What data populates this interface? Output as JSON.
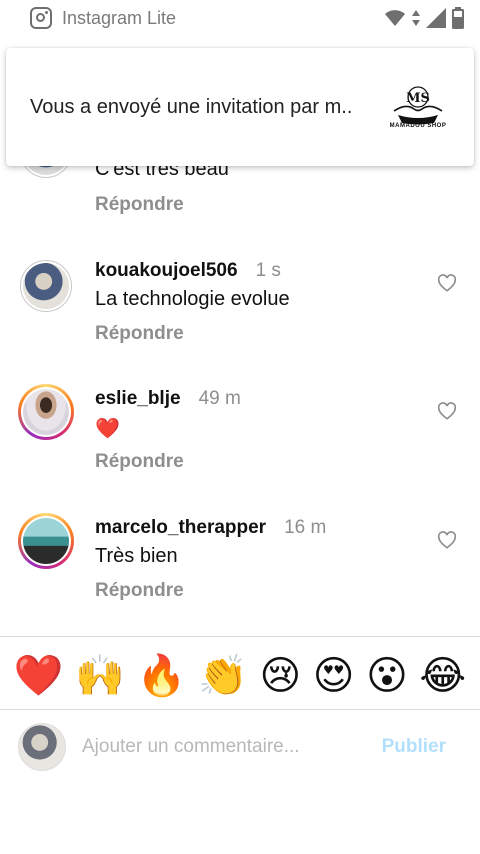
{
  "status_bar": {
    "app_name": "Instagram Lite"
  },
  "notification": {
    "text": "Vous a envoyé une invitation par m..",
    "logo_mark": "MS",
    "logo_brand": "MAMADOU SHOP"
  },
  "partial_comment": {
    "text": "C'est très beau",
    "reply_label": "Répondre"
  },
  "comments": [
    {
      "username": "kouakoujoel506",
      "time": "1 s",
      "text": "La technologie evolue",
      "reply_label": "Répondre"
    },
    {
      "username": "eslie_blje",
      "time": "49 m",
      "text": "❤️",
      "reply_label": "Répondre"
    },
    {
      "username": "marcelo_therapper",
      "time": "16 m",
      "text": "Très bien",
      "reply_label": "Répondre"
    }
  ],
  "reactions": [
    "❤️",
    "🙌",
    "🔥",
    "👏",
    "😢",
    "😍",
    "😮",
    "😂"
  ],
  "composer": {
    "placeholder": "Ajouter un commentaire...",
    "post_label": "Publier"
  },
  "colors": {
    "accent_disabled": "#b2dffc",
    "secondary_text": "#8e8e8e"
  }
}
